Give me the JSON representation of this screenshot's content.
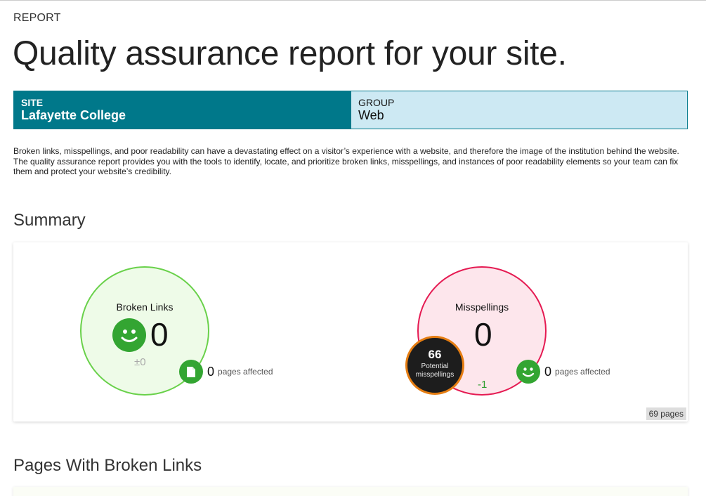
{
  "header": {
    "eyebrow": "REPORT",
    "title": "Quality assurance report for your site."
  },
  "meta": {
    "site_label": "SITE",
    "site_value": "Lafayette College",
    "group_label": "GROUP",
    "group_value": "Web"
  },
  "intro": "Broken links, misspellings, and poor readability can have a devastating effect on a visitor’s experience with a website, and therefore the image of the institution behind the website. The quality assurance report provides you with the tools to identify, locate, and prioritize broken links, misspellings, and instances of poor readability elements so your team can fix them and protect your website’s credibility.",
  "summary": {
    "heading": "Summary",
    "broken_links": {
      "label": "Broken Links",
      "count": "0",
      "delta": "±0",
      "status_icon": "smiley-face-icon",
      "pages_affected_count": "0",
      "pages_affected_label": "pages affected",
      "pages_affected_icon": "document-icon"
    },
    "misspellings": {
      "label": "Misspellings",
      "count": "0",
      "delta": "-1",
      "potential_count": "66",
      "potential_label": "Potential misspellings",
      "pages_affected_count": "0",
      "pages_affected_label": "pages affected",
      "pages_affected_icon": "smiley-face-icon"
    },
    "pages_badge": "69 pages"
  },
  "broken_section": {
    "heading": "Pages With Broken Links"
  },
  "colors": {
    "site_bg": "#00788a",
    "group_bg": "#cde9f3",
    "good_green": "#33a532",
    "links_ring": "#69d14a",
    "spell_ring": "#e51a52",
    "potential_ring": "#e57d12"
  }
}
